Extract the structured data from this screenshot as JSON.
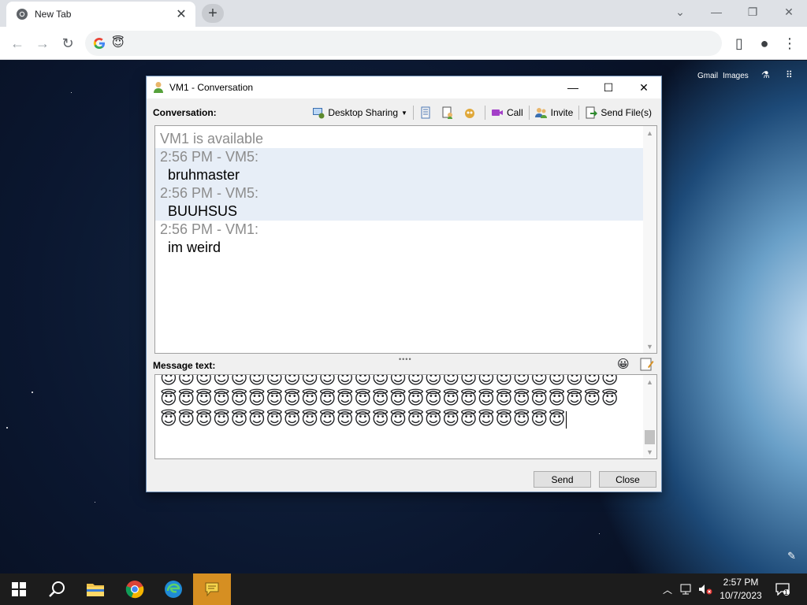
{
  "browser": {
    "tab_title": "New Tab",
    "omnibox_emoji": "😇",
    "page_links": [
      "Gmail",
      "Images"
    ]
  },
  "window": {
    "title": "VM1 - Conversation",
    "conversation_label": "Conversation:",
    "toolbar": {
      "desktop_sharing": "Desktop Sharing",
      "call": "Call",
      "invite": "Invite",
      "send_files": "Send File(s)"
    },
    "history": {
      "status": "VM1 is available",
      "messages": [
        {
          "header": "2:56 PM - VM5:",
          "text": "bruhmaster"
        },
        {
          "header": "2:56 PM - VM5:",
          "text": "BUUHSUS"
        },
        {
          "header": "2:56 PM - VM1:",
          "text": "im weird"
        }
      ]
    },
    "message_label": "Message text:",
    "compose_emoji": "😇",
    "send_label": "Send",
    "close_label": "Close"
  },
  "taskbar": {
    "time": "2:57 PM",
    "date": "10/7/2023",
    "notification_count": "1"
  },
  "colors": {
    "taskbar_active": "#d68f22",
    "history_highlight": "#e7eef7"
  }
}
